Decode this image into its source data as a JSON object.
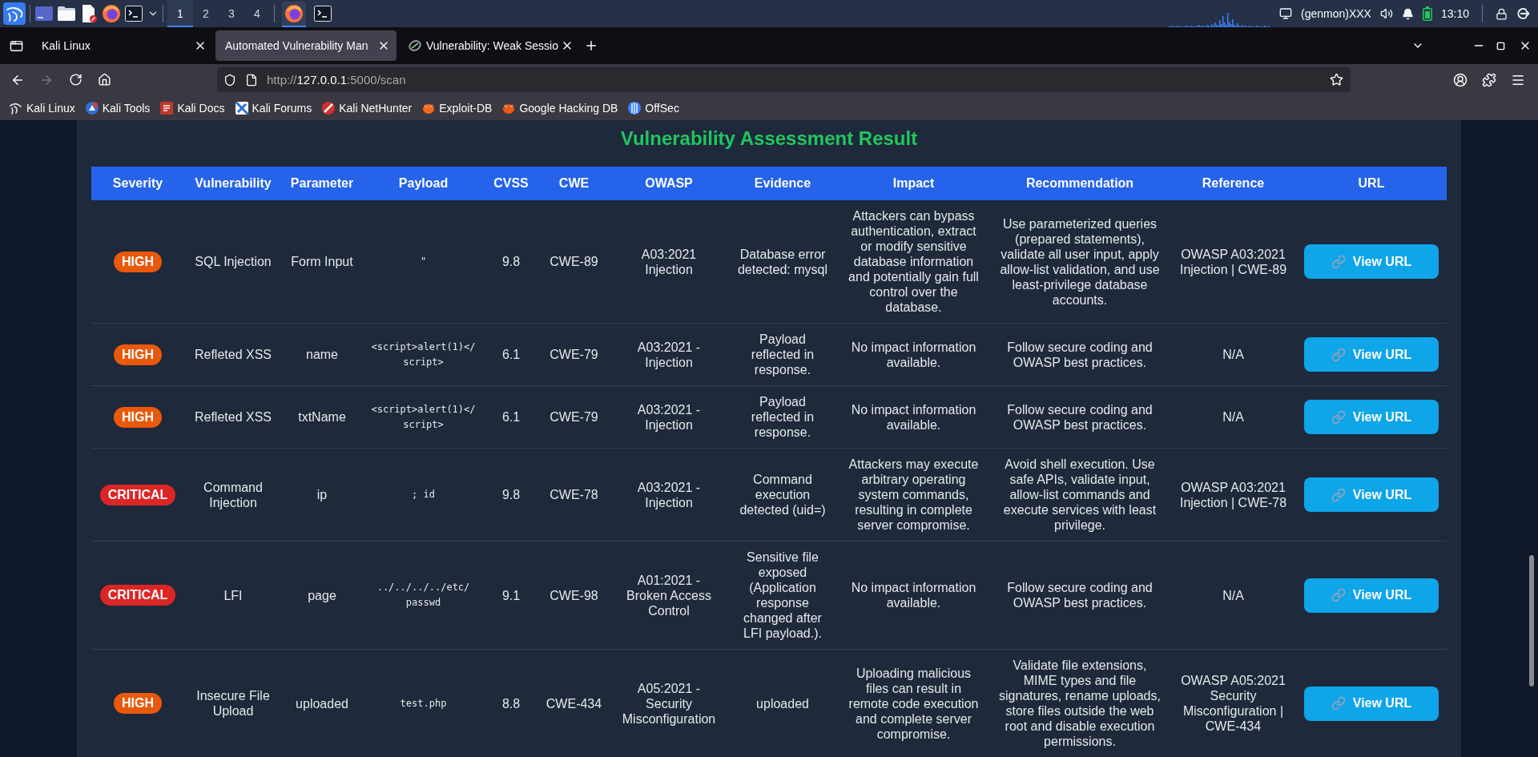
{
  "taskbar": {
    "workspaces": [
      {
        "label": "1",
        "selected": true
      },
      {
        "label": "2",
        "selected": false
      },
      {
        "label": "3",
        "selected": false
      },
      {
        "label": "4",
        "selected": false
      }
    ],
    "windows": [
      {
        "kind": "browser",
        "selected": true
      },
      {
        "kind": "terminal",
        "selected": false
      }
    ],
    "status_text": "(genmon)XXX",
    "clock": "13:10"
  },
  "browser": {
    "tabs": [
      {
        "title": "Kali Linux",
        "selected": false,
        "favicon": false
      },
      {
        "title": "Automated Vulnerability Man",
        "selected": true,
        "favicon": false
      },
      {
        "title": "Vulnerability: Weak Sessio",
        "selected": false,
        "favicon": true
      }
    ],
    "back_enabled": true,
    "forward_enabled": false,
    "url": "http://127.0.0.1:5000/scan",
    "bookmarks": [
      "Kali Linux",
      "Kali Tools",
      "Kali Docs",
      "Kali Forums",
      "Kali NetHunter",
      "Exploit-DB",
      "Google Hacking DB",
      "OffSec"
    ]
  },
  "page": {
    "title": "Vulnerability Assessment Result",
    "table": {
      "columns": [
        "Severity",
        "Vulnerability",
        "Parameter",
        "Payload",
        "CVSS",
        "CWE",
        "OWASP",
        "Evidence",
        "Impact",
        "Recommendation",
        "Reference",
        "URL"
      ],
      "rows": [
        {
          "severity": {
            "label": "HIGH",
            "color": "#ea580c"
          },
          "vulnerability": "SQL Injection",
          "parameter": "Form Input",
          "payload": "\"",
          "cvss": "9.8",
          "cwe": "CWE-89",
          "owasp": "A03:2021 Injection",
          "evidence": "Database error detected: mysql",
          "impact": "Attackers can bypass authentication, extract or modify sensitive database information and potentially gain full control over the database.",
          "recommendation": "Use parameterized queries (prepared statements), validate all user input, apply allow-list validation, and use least-privilege database accounts.",
          "reference": "OWASP A03:2021 Injection | CWE-89",
          "action": "View URL"
        },
        {
          "severity": {
            "label": "HIGH",
            "color": "#ea580c"
          },
          "vulnerability": "Refleted XSS",
          "parameter": "name",
          "payload": "<script>alert(1)</script>",
          "cvss": "6.1",
          "cwe": "CWE-79",
          "owasp": "A03:2021 - Injection",
          "evidence": "Payload reflected in response.",
          "impact": "No impact information available.",
          "recommendation": "Follow secure coding and OWASP best practices.",
          "reference": "N/A",
          "action": "View URL"
        },
        {
          "severity": {
            "label": "HIGH",
            "color": "#ea580c"
          },
          "vulnerability": "Refleted XSS",
          "parameter": "txtName",
          "payload": "<script>alert(1)</script>",
          "cvss": "6.1",
          "cwe": "CWE-79",
          "owasp": "A03:2021 - Injection",
          "evidence": "Payload reflected in response.",
          "impact": "No impact information available.",
          "recommendation": "Follow secure coding and OWASP best practices.",
          "reference": "N/A",
          "action": "View URL"
        },
        {
          "severity": {
            "label": "CRITICAL",
            "color": "#dc2626"
          },
          "vulnerability": "Command Injection",
          "parameter": "ip",
          "payload": "; id",
          "cvss": "9.8",
          "cwe": "CWE-78",
          "owasp": "A03:2021 - Injection",
          "evidence": "Command execution detected (uid=)",
          "impact": "Attackers may execute arbitrary operating system commands, resulting in complete server compromise.",
          "recommendation": "Avoid shell execution. Use safe APIs, validate input, allow-list commands and execute services with least privilege.",
          "reference": "OWASP A03:2021 Injection | CWE-78",
          "action": "View URL"
        },
        {
          "severity": {
            "label": "CRITICAL",
            "color": "#dc2626"
          },
          "vulnerability": "LFI",
          "parameter": "page",
          "payload": "../../../../etc/passwd",
          "cvss": "9.1",
          "cwe": "CWE-98",
          "owasp": "A01:2021 - Broken Access Control",
          "evidence": "Sensitive file exposed (Application response changed after LFI payload.).",
          "impact": "No impact information available.",
          "recommendation": "Follow secure coding and OWASP best practices.",
          "reference": "N/A",
          "action": "View URL"
        },
        {
          "severity": {
            "label": "HIGH",
            "color": "#ea580c"
          },
          "vulnerability": "Insecure File Upload",
          "parameter": "uploaded",
          "payload": "test.php",
          "cvss": "8.8",
          "cwe": "CWE-434",
          "owasp": "A05:2021 - Security Misconfiguration",
          "evidence": "uploaded",
          "impact": "Uploading malicious files can result in remote code execution and complete server compromise.",
          "recommendation": "Validate file extensions, MIME types and file signatures, rename uploads, store files outside the web root and disable execution permissions.",
          "reference": "OWASP A05:2021 Security Misconfiguration | CWE-434",
          "action": "View URL"
        }
      ]
    }
  }
}
